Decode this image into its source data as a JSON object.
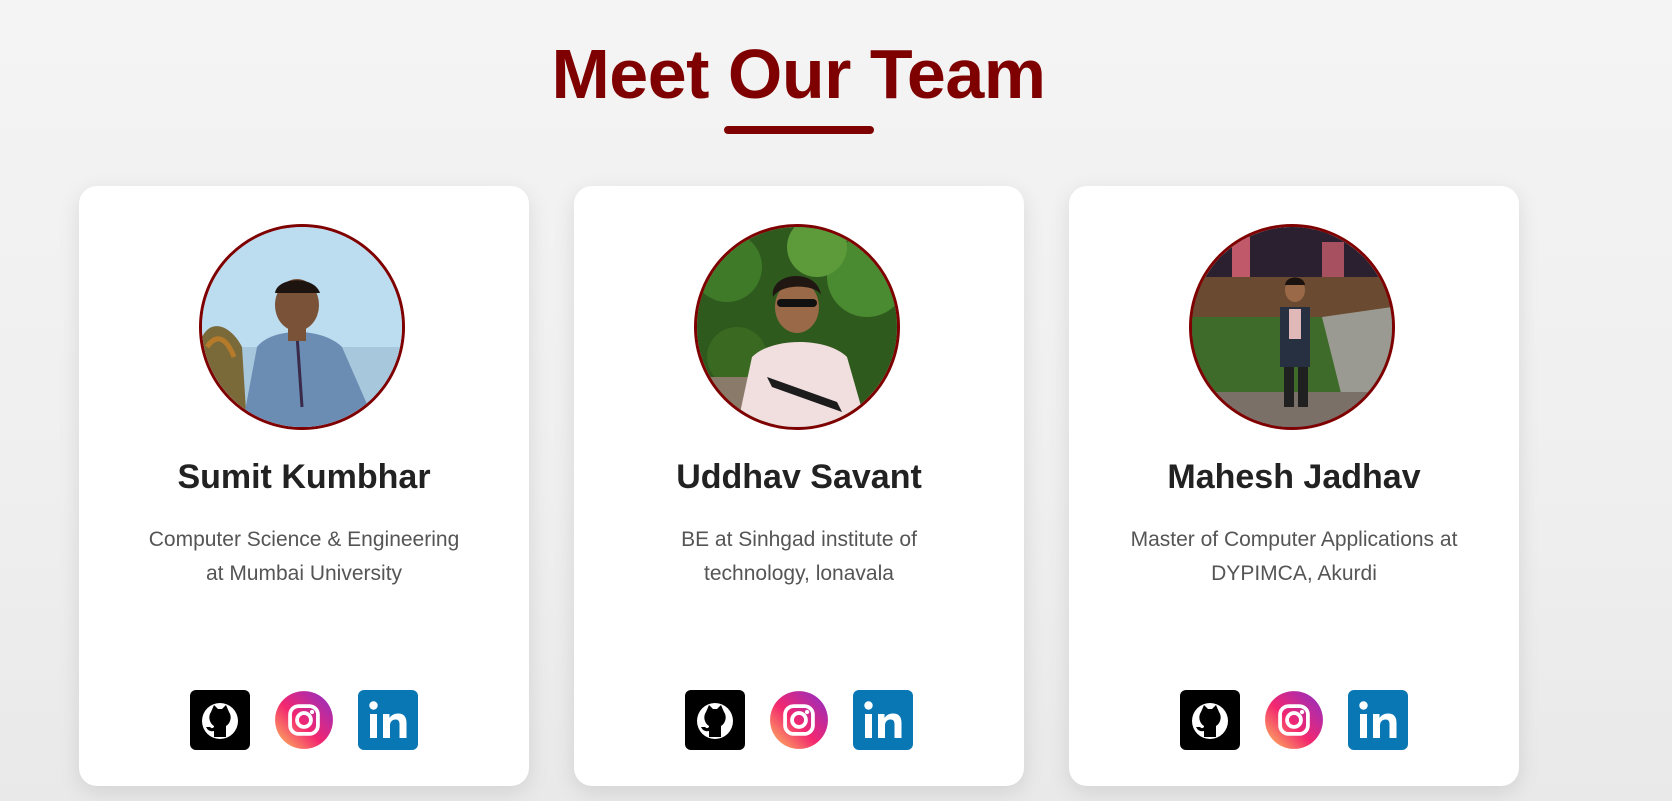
{
  "section": {
    "title": "Meet Our Team"
  },
  "members": [
    {
      "name": "Sumit Kumbhar",
      "role": "Computer Science & Engineering at Mumbai University",
      "social": [
        "github-icon",
        "instagram-icon",
        "linkedin-icon"
      ]
    },
    {
      "name": "Uddhav Savant",
      "role": "BE at Sinhgad institute of technology, lonavala",
      "social": [
        "github-icon",
        "instagram-icon",
        "linkedin-icon"
      ]
    },
    {
      "name": "Mahesh Jadhav",
      "role": "Master of Computer Applications at DYPIMCA, Akurdi",
      "social": [
        "github-icon",
        "instagram-icon",
        "linkedin-icon"
      ]
    }
  ],
  "colors": {
    "accent": "#7f0000",
    "github": "#000000",
    "linkedin": "#0a77b5",
    "instagram_from": "#feda75",
    "instagram_to": "#962fbf"
  }
}
